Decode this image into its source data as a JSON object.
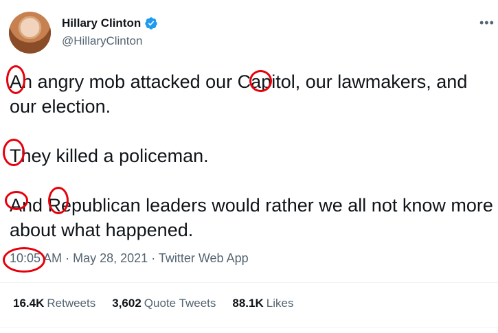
{
  "author": {
    "display_name": "Hillary Clinton",
    "handle": "@HillaryClinton",
    "verified_icon": "verified-badge-icon",
    "accent_color": "#1d9bf0"
  },
  "tweet": {
    "text": "An angry mob attacked our Capitol, our lawmakers, and our election.\n\nThey killed a policeman.\n\nAnd Republican leaders would rather we all not know more about what happened."
  },
  "meta": {
    "time": "10:05 AM",
    "separator": "·",
    "date": "May 28, 2021",
    "source": "Twitter Web App"
  },
  "stats": [
    {
      "count": "16.4K",
      "label": "Retweets"
    },
    {
      "count": "3,602",
      "label": "Quote Tweets"
    },
    {
      "count": "88.1K",
      "label": "Likes"
    }
  ],
  "annotations": {
    "color": "#e6000b"
  }
}
